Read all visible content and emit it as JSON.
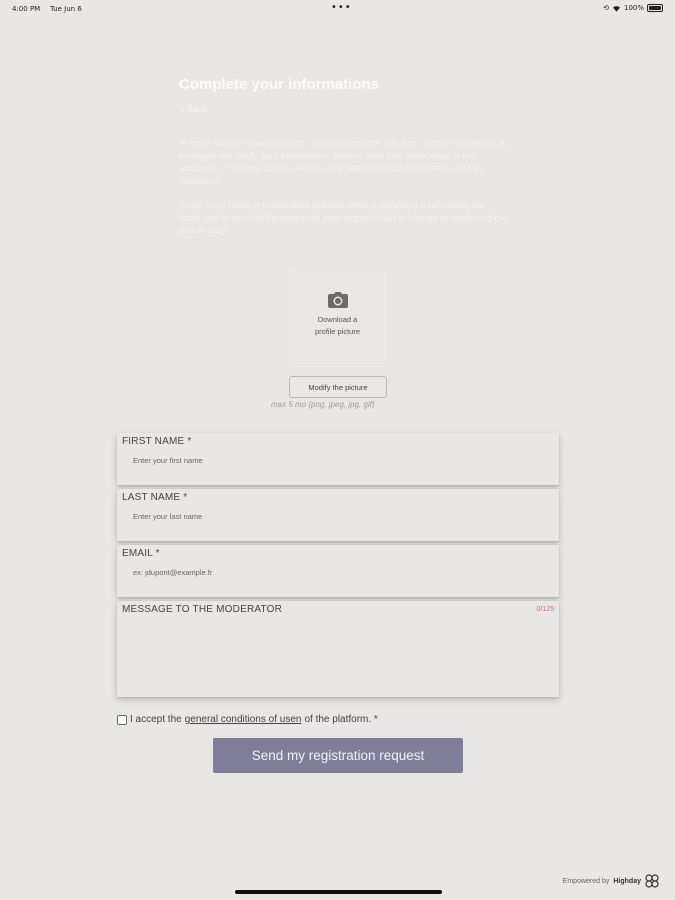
{
  "status_bar": {
    "time": "4:00 PM",
    "date": "Tue Jun 6",
    "dots": "•••",
    "battery": "100%"
  },
  "header": {
    "title": "Complete your informations",
    "back_label": "< Back"
  },
  "intro": {
    "paragraph1": "In order to join the application , please complete this form. Once completed, a manager will verify your information. Please note that verification is not automatic. You may obtain access only between your registration and its validation.",
    "paragraph2": "If you have made a registration request without obtaining a response, we invite you to contact the person in your organization in charge of deploying the tool directly."
  },
  "picture": {
    "icon": "camera-icon",
    "label": "Download a profile picture",
    "modify_label": "Modify the picture",
    "hint": "max 5 mo (png, jpeg, jpg, gif)"
  },
  "form": {
    "first_name": {
      "label": "FIRST NAME *",
      "placeholder": "Enter your first name"
    },
    "last_name": {
      "label": "LAST NAME *",
      "placeholder": "Enter your last name"
    },
    "email": {
      "label": "EMAIL *",
      "placeholder": "ex: jdupont@example.fr"
    },
    "message": {
      "label": "MESSAGE TO THE MODERATOR",
      "counter": "0/125",
      "placeholder": ""
    }
  },
  "terms": {
    "prefix": "I accept the",
    "link": "general conditions of usen",
    "suffix": "of the platform. *"
  },
  "submit_label": "Send my registration request",
  "footer": {
    "powered_by": "Empowered by",
    "brand": "Highday",
    "logo_icon": "highday-logo-icon"
  },
  "colors": {
    "background": "#e8e7e5",
    "button": "#7e7e9a",
    "counter": "#d36f6f"
  }
}
